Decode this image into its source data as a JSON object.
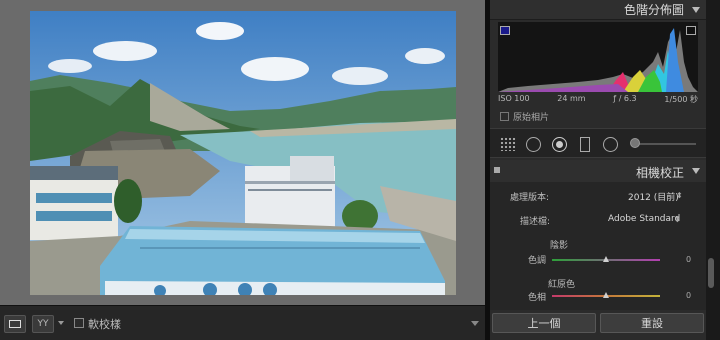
{
  "toolbar": {
    "compare_label": "YY",
    "softproof_label": "軟校樣"
  },
  "histogram": {
    "title": "色階分佈圖",
    "iso": "ISO 100",
    "focal": "24 mm",
    "aperture": "ƒ / 6.3",
    "shutter": "1/500 秒",
    "original_label": "原始相片"
  },
  "camera_calibration": {
    "title": "相機校正",
    "process_label": "處理版本:",
    "process_value": "2012 (目前)",
    "profile_label": "描述檔:",
    "profile_value": "Adobe Standard",
    "shadows_label": "陰影",
    "shadow_tint_label": "色調",
    "shadow_tint_value": "0",
    "red_primary_label": "紅原色",
    "red_hue_label": "色相",
    "red_hue_value": "0"
  },
  "buttons": {
    "previous": "上一個",
    "reset": "重設"
  },
  "icons": {
    "view_mode": "loupe-view-icon",
    "panel_collapse": "triangle-down-icon",
    "tool_grid": "grid-overlay-icon",
    "tool_crop": "crop-icon",
    "tool_spot": "spot-removal-icon",
    "tool_redeye": "red-eye-icon",
    "tool_gradient": "graduated-filter-icon",
    "tool_brush": "adjustment-brush-icon"
  }
}
